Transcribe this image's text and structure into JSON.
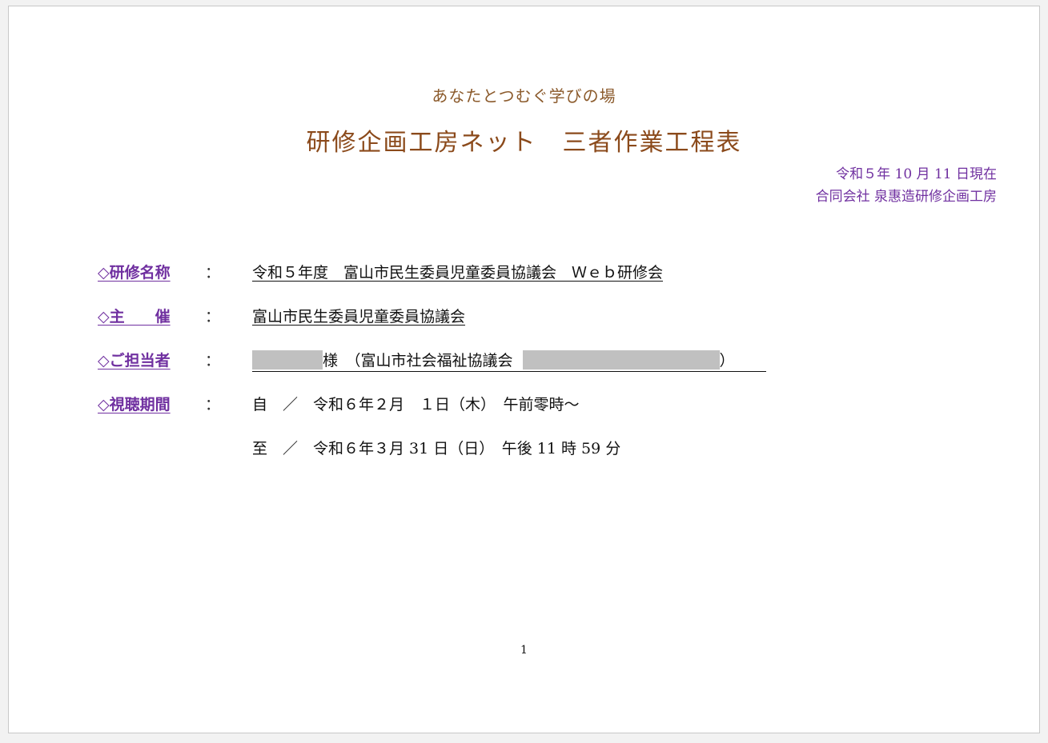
{
  "header": {
    "subtitle": "あなたとつむぐ学びの場",
    "title": "研修企画工房ネット　三者作業工程表",
    "date": "令和５年 10 月 11 日現在",
    "company": "合同会社 泉惠造研修企画工房"
  },
  "fields": {
    "training_name": {
      "label": "◇研修名称",
      "colon": "：",
      "value": "令和５年度　富山市民生委員児童委員協議会　Ｗｅｂ研修会"
    },
    "organizer": {
      "label": "◇主　　催",
      "colon": "：",
      "value": "富山市民生委員児童委員協議会"
    },
    "contact": {
      "label": "◇ご担当者",
      "colon": "：",
      "honorific": "様　（富山市社会福祉協議会",
      "close_paren": "）"
    },
    "viewing_period": {
      "label": "◇視聴期間",
      "colon": "：",
      "start": "自　／　令和６年２月　１日（木）　午前零時～",
      "end": "至　／　令和６年３月 31 日（日）　午後 11 時 59 分"
    }
  },
  "footer": {
    "page_number": "1"
  }
}
